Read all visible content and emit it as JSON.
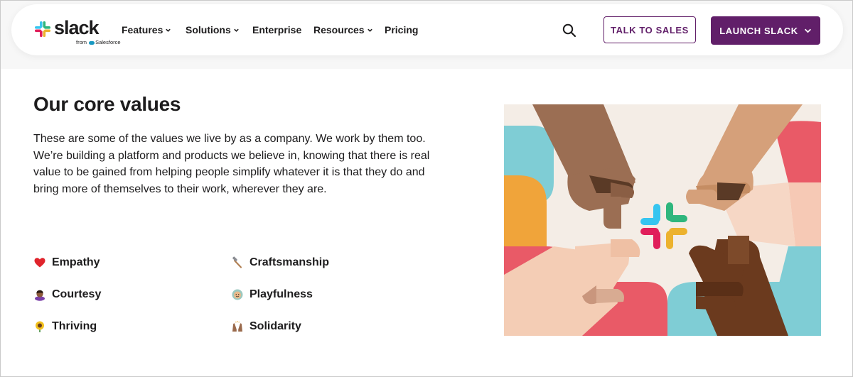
{
  "logo": {
    "word": "slack",
    "sub_from": "from",
    "sub_brand": "Salesforce"
  },
  "nav": {
    "items": [
      {
        "label": "Features",
        "dropdown": true
      },
      {
        "label": "Solutions",
        "dropdown": true
      },
      {
        "label": "Enterprise",
        "dropdown": false
      },
      {
        "label": "Resources",
        "dropdown": true
      },
      {
        "label": "Pricing",
        "dropdown": false
      }
    ],
    "search_icon": "search-icon",
    "talk_to_sales": "TALK TO SALES",
    "launch_slack": "LAUNCH SLACK"
  },
  "main": {
    "heading": "Our core values",
    "paragraph": "These are some of the values we live by as a company. We work by them too. We’re building a platform and products we believe in, knowing that there is real value to be gained from helping people simplify whatever it is that they do and bring more of themselves to their work, wherever they are.",
    "values": [
      {
        "label": "Empathy",
        "icon": "heart-icon"
      },
      {
        "label": "Craftsmanship",
        "icon": "hammer-icon"
      },
      {
        "label": "Courtesy",
        "icon": "person-bowing-icon"
      },
      {
        "label": "Playfulness",
        "icon": "smiling-face-icon"
      },
      {
        "label": "Thriving",
        "icon": "sunflower-icon"
      },
      {
        "label": "Solidarity",
        "icon": "raised-hands-icon"
      }
    ]
  },
  "colors": {
    "brand_aubergine": "#611f69",
    "slack_blue": "#36c5f0",
    "slack_green": "#2eb67d",
    "slack_yellow": "#ecb22e",
    "slack_red": "#e01e5a",
    "text": "#1d1c1d"
  },
  "illustration": {
    "name": "hands-assembling-slack-logo-illustration"
  }
}
